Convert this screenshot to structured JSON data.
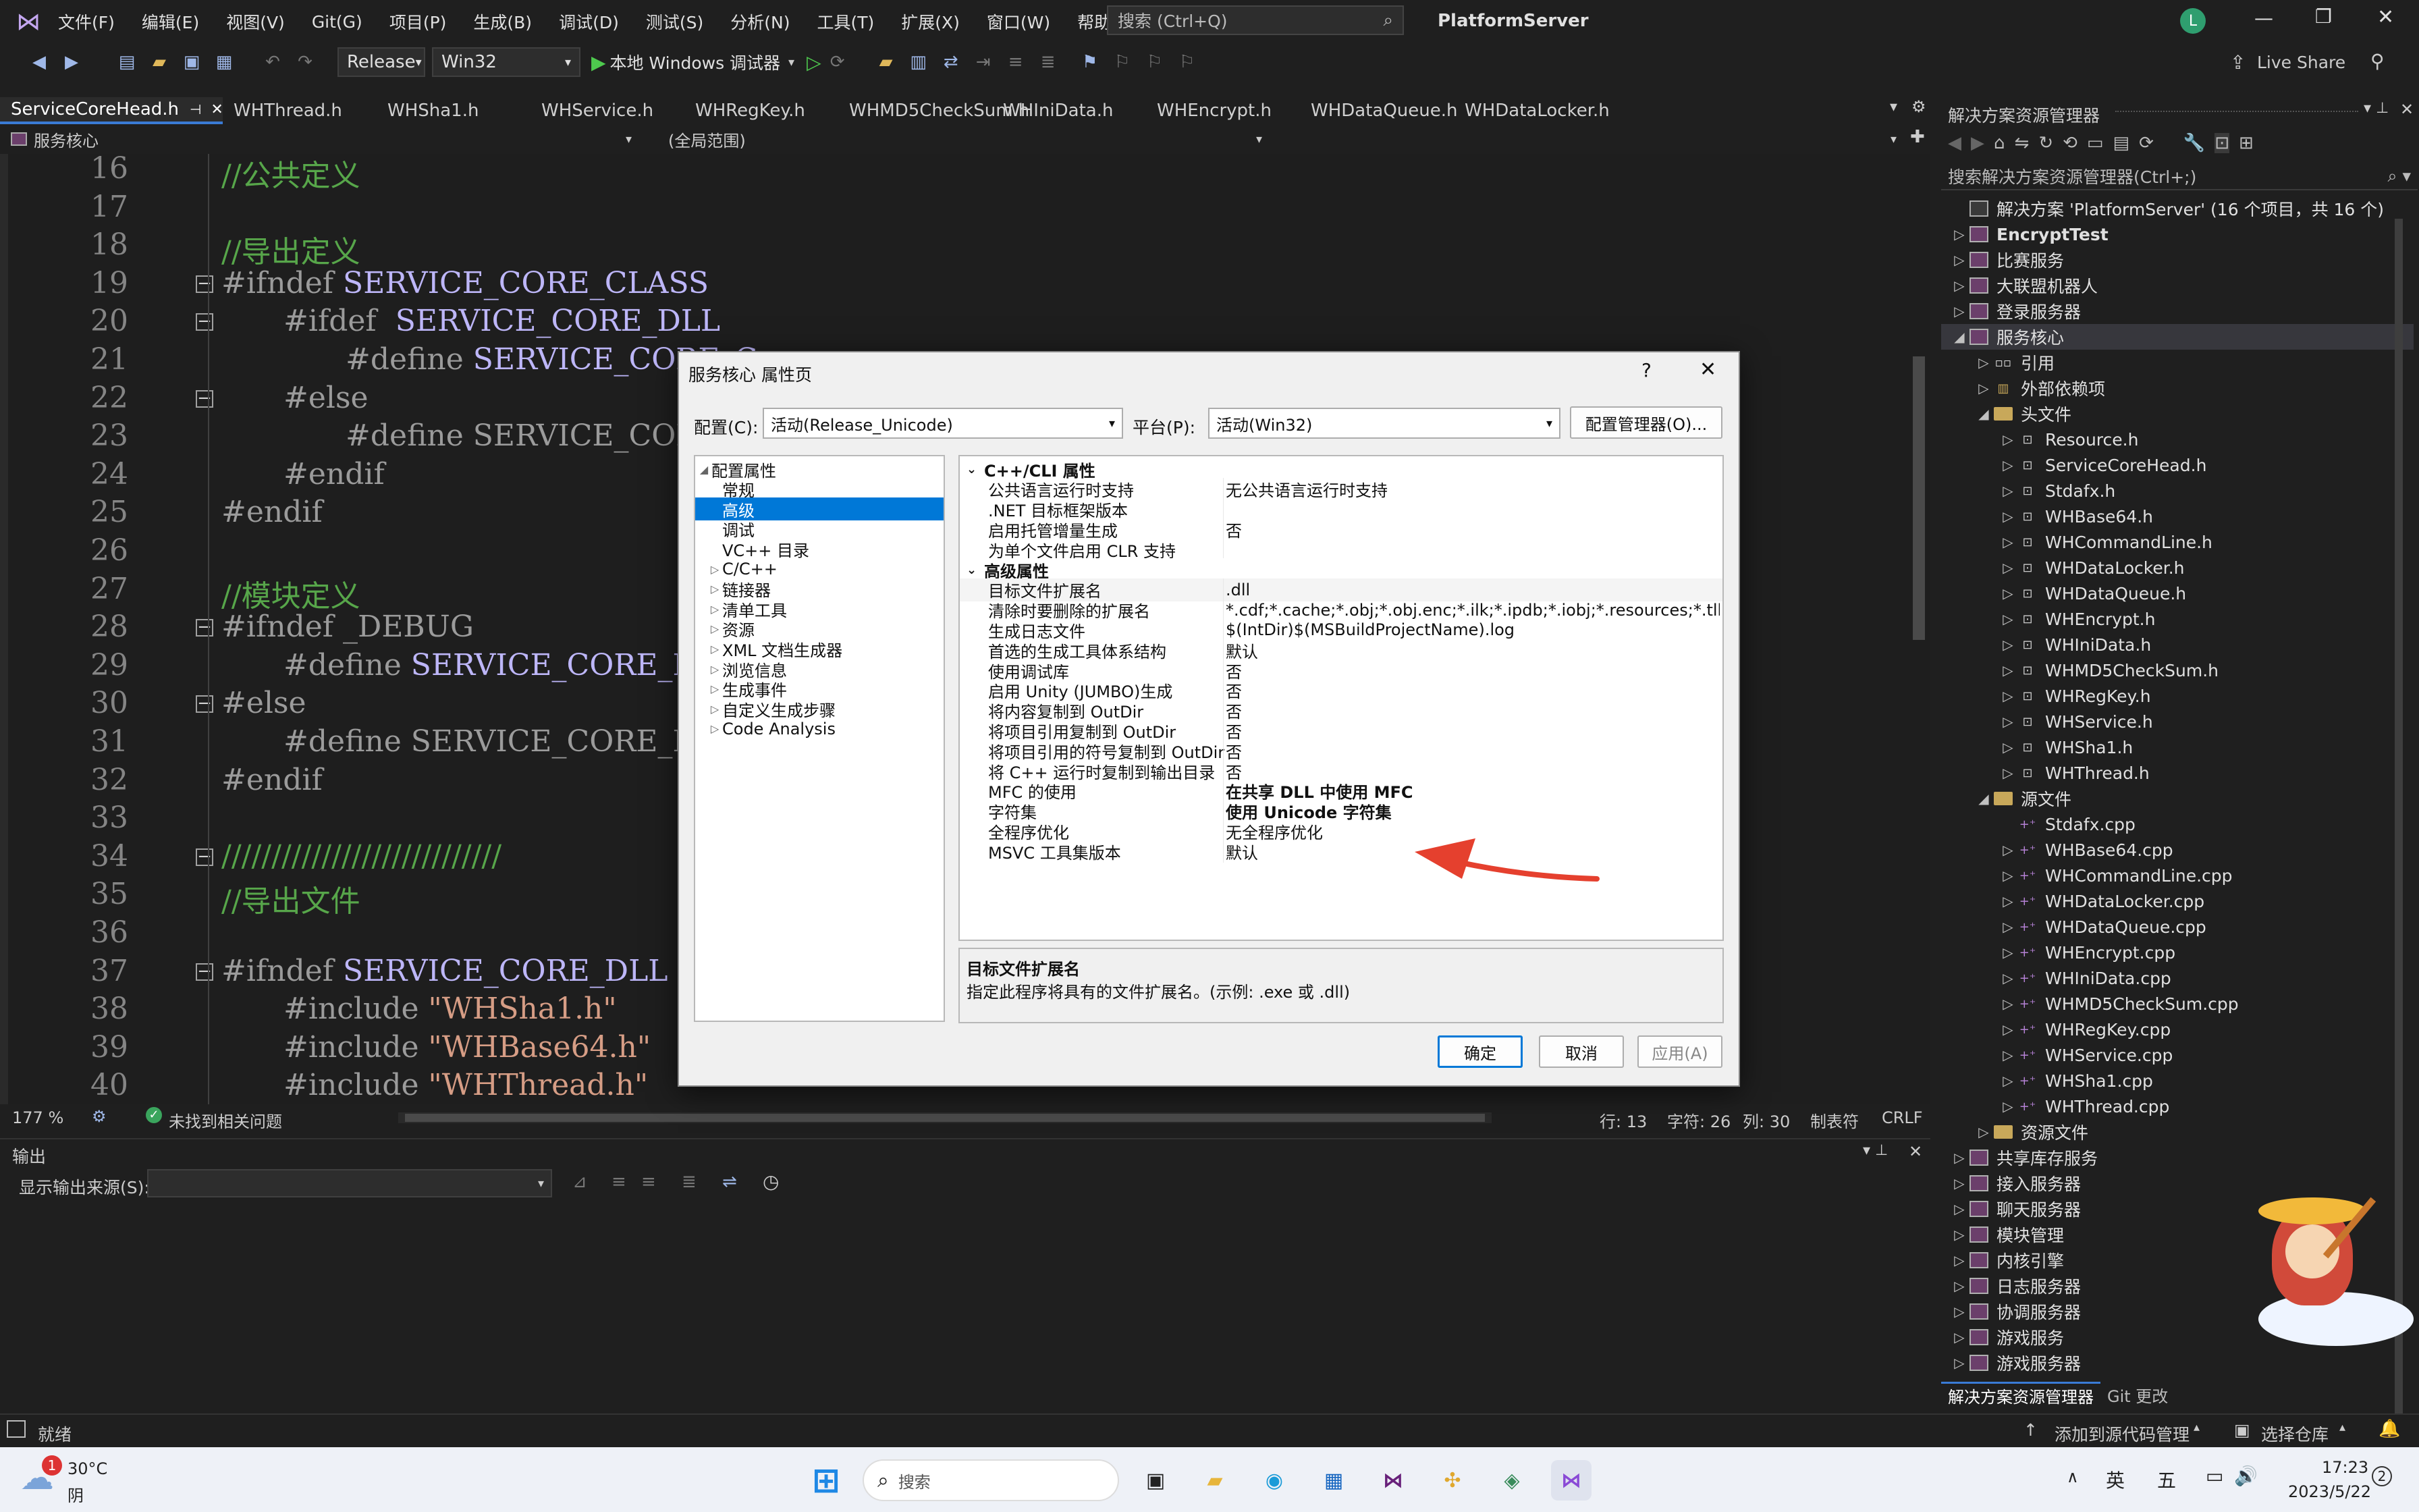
{
  "title_bar": {
    "menus": [
      "文件(F)",
      "编辑(E)",
      "视图(V)",
      "Git(G)",
      "项目(P)",
      "生成(B)",
      "调试(D)",
      "测试(S)",
      "分析(N)",
      "工具(T)",
      "扩展(X)",
      "窗口(W)",
      "帮助(H)"
    ],
    "search_placeholder": "搜索 (Ctrl+Q)",
    "solution_name": "PlatformServer",
    "avatar_letter": "L"
  },
  "toolbar": {
    "config": "Release",
    "platform": "Win32",
    "debugger": "本地 Windows 调试器",
    "live_share": "Live Share"
  },
  "tabs": [
    "ServiceCoreHead.h",
    "WHThread.h",
    "WHSha1.h",
    "WHService.h",
    "WHRegKey.h",
    "WHMD5CheckSum.h",
    "WHIniData.h",
    "WHEncrypt.h",
    "WHDataQueue.h",
    "WHDataLocker.h"
  ],
  "nav": {
    "project": "服务核心",
    "scope": "(全局范围)"
  },
  "editor": {
    "lines": [
      {
        "n": "16",
        "t": "//公共定义",
        "k": "cm",
        "i": 0
      },
      {
        "n": "17",
        "t": "",
        "k": "",
        "i": 0
      },
      {
        "n": "18",
        "t": "//导出定义",
        "k": "cm",
        "i": 0
      },
      {
        "n": "19",
        "t": "#ifndef ",
        "m": "SERVICE_CORE_CLASS",
        "k": "pp",
        "i": 0,
        "f": true
      },
      {
        "n": "20",
        "t": "#ifdef  ",
        "m": "SERVICE_CORE_DLL",
        "k": "pp",
        "i": 1,
        "f": true
      },
      {
        "n": "21",
        "t": "#define ",
        "m": "SERVICE_CORE_C",
        "k": "pp",
        "i": 2
      },
      {
        "n": "22",
        "t": "#else",
        "k": "pp",
        "i": 1,
        "f": true
      },
      {
        "n": "23",
        "t": "#define SERVICE_CORE_C",
        "k": "pp",
        "i": 2
      },
      {
        "n": "24",
        "t": "#endif",
        "k": "pp",
        "i": 1
      },
      {
        "n": "25",
        "t": "#endif",
        "k": "pp",
        "i": 0
      },
      {
        "n": "26",
        "t": "",
        "k": "",
        "i": 0
      },
      {
        "n": "27",
        "t": "//模块定义",
        "k": "cm",
        "i": 0
      },
      {
        "n": "28",
        "t": "#ifndef _DEBUG",
        "k": "pp",
        "i": 0,
        "f": true
      },
      {
        "n": "29",
        "t": "#define ",
        "m": "SERVICE_CORE_DLL_N",
        "k": "pp",
        "i": 1
      },
      {
        "n": "30",
        "t": "#else",
        "k": "pp",
        "i": 0,
        "f": true
      },
      {
        "n": "31",
        "t": "#define SERVICE_CORE_DLL_N",
        "k": "pp",
        "i": 1
      },
      {
        "n": "32",
        "t": "#endif",
        "k": "pp",
        "i": 0
      },
      {
        "n": "33",
        "t": "",
        "k": "",
        "i": 0
      },
      {
        "n": "34",
        "t": "////////////////////////////",
        "k": "cm",
        "i": 0,
        "f": true
      },
      {
        "n": "35",
        "t": "//导出文件",
        "k": "cm",
        "i": 0
      },
      {
        "n": "36",
        "t": "",
        "k": "",
        "i": 0
      },
      {
        "n": "37",
        "t": "#ifndef ",
        "m": "SERVICE_CORE_DLL",
        "k": "pp",
        "i": 0,
        "f": true
      },
      {
        "n": "38",
        "t": "#include ",
        "s": "\"WHSha1.h\"",
        "k": "pp",
        "i": 1
      },
      {
        "n": "39",
        "t": "#include ",
        "s": "\"WHBase64.h\"",
        "k": "pp",
        "i": 1
      },
      {
        "n": "40",
        "t": "#include ",
        "s": "\"WHThread.h\"",
        "k": "pp",
        "i": 1
      }
    ]
  },
  "editor_status": {
    "zoom": "177 %",
    "issues": "未找到相关问题",
    "line": "行: 13",
    "char": "字符: 26",
    "col": "列: 30",
    "tabs": "制表符",
    "eol": "CRLF"
  },
  "output": {
    "title": "输出",
    "source_label": "显示输出来源(S):"
  },
  "solution_explorer": {
    "title": "解决方案资源管理器",
    "search_placeholder": "搜索解决方案资源管理器(Ctrl+;)",
    "bottom_tabs": [
      "解决方案资源管理器",
      "Git 更改"
    ],
    "items": [
      {
        "l": "解决方案 'PlatformServer' (16 个项目，共 16 个)",
        "d": 0,
        "t": "sol",
        "a": ""
      },
      {
        "l": "EncryptTest",
        "d": 0,
        "t": "proj",
        "a": "▷",
        "b": true
      },
      {
        "l": "比赛服务",
        "d": 0,
        "t": "proj",
        "a": "▷"
      },
      {
        "l": "大联盟机器人",
        "d": 0,
        "t": "proj",
        "a": "▷"
      },
      {
        "l": "登录服务器",
        "d": 0,
        "t": "proj",
        "a": "▷"
      },
      {
        "l": "服务核心",
        "d": 0,
        "t": "proj",
        "a": "◢",
        "sel": true
      },
      {
        "l": "引用",
        "d": 1,
        "t": "ref",
        "a": "▷"
      },
      {
        "l": "外部依赖项",
        "d": 1,
        "t": "ext",
        "a": "▷"
      },
      {
        "l": "头文件",
        "d": 1,
        "t": "folder",
        "a": "◢"
      },
      {
        "l": "Resource.h",
        "d": 2,
        "t": "h",
        "a": "▷"
      },
      {
        "l": "ServiceCoreHead.h",
        "d": 2,
        "t": "h",
        "a": "▷"
      },
      {
        "l": "Stdafx.h",
        "d": 2,
        "t": "h",
        "a": "▷"
      },
      {
        "l": "WHBase64.h",
        "d": 2,
        "t": "h",
        "a": "▷"
      },
      {
        "l": "WHCommandLine.h",
        "d": 2,
        "t": "h",
        "a": "▷"
      },
      {
        "l": "WHDataLocker.h",
        "d": 2,
        "t": "h",
        "a": "▷"
      },
      {
        "l": "WHDataQueue.h",
        "d": 2,
        "t": "h",
        "a": "▷"
      },
      {
        "l": "WHEncrypt.h",
        "d": 2,
        "t": "h",
        "a": "▷"
      },
      {
        "l": "WHIniData.h",
        "d": 2,
        "t": "h",
        "a": "▷"
      },
      {
        "l": "WHMD5CheckSum.h",
        "d": 2,
        "t": "h",
        "a": "▷"
      },
      {
        "l": "WHRegKey.h",
        "d": 2,
        "t": "h",
        "a": "▷"
      },
      {
        "l": "WHService.h",
        "d": 2,
        "t": "h",
        "a": "▷"
      },
      {
        "l": "WHSha1.h",
        "d": 2,
        "t": "h",
        "a": "▷"
      },
      {
        "l": "WHThread.h",
        "d": 2,
        "t": "h",
        "a": "▷"
      },
      {
        "l": "源文件",
        "d": 1,
        "t": "folder",
        "a": "◢"
      },
      {
        "l": "Stdafx.cpp",
        "d": 2,
        "t": "cpp",
        "a": ""
      },
      {
        "l": "WHBase64.cpp",
        "d": 2,
        "t": "cpp",
        "a": "▷"
      },
      {
        "l": "WHCommandLine.cpp",
        "d": 2,
        "t": "cpp",
        "a": "▷"
      },
      {
        "l": "WHDataLocker.cpp",
        "d": 2,
        "t": "cpp",
        "a": "▷"
      },
      {
        "l": "WHDataQueue.cpp",
        "d": 2,
        "t": "cpp",
        "a": "▷"
      },
      {
        "l": "WHEncrypt.cpp",
        "d": 2,
        "t": "cpp",
        "a": "▷"
      },
      {
        "l": "WHIniData.cpp",
        "d": 2,
        "t": "cpp",
        "a": "▷"
      },
      {
        "l": "WHMD5CheckSum.cpp",
        "d": 2,
        "t": "cpp",
        "a": "▷"
      },
      {
        "l": "WHRegKey.cpp",
        "d": 2,
        "t": "cpp",
        "a": "▷"
      },
      {
        "l": "WHService.cpp",
        "d": 2,
        "t": "cpp",
        "a": "▷"
      },
      {
        "l": "WHSha1.cpp",
        "d": 2,
        "t": "cpp",
        "a": "▷"
      },
      {
        "l": "WHThread.cpp",
        "d": 2,
        "t": "cpp",
        "a": "▷"
      },
      {
        "l": "资源文件",
        "d": 1,
        "t": "folder",
        "a": "▷"
      },
      {
        "l": "共享库存服务",
        "d": 0,
        "t": "proj",
        "a": "▷"
      },
      {
        "l": "接入服务器",
        "d": 0,
        "t": "proj",
        "a": "▷"
      },
      {
        "l": "聊天服务器",
        "d": 0,
        "t": "proj",
        "a": "▷"
      },
      {
        "l": "模块管理",
        "d": 0,
        "t": "proj",
        "a": "▷"
      },
      {
        "l": "内核引擎",
        "d": 0,
        "t": "proj",
        "a": "▷"
      },
      {
        "l": "日志服务器",
        "d": 0,
        "t": "proj",
        "a": "▷"
      },
      {
        "l": "协调服务器",
        "d": 0,
        "t": "proj",
        "a": "▷"
      },
      {
        "l": "游戏服务",
        "d": 0,
        "t": "proj",
        "a": "▷"
      },
      {
        "l": "游戏服务器",
        "d": 0,
        "t": "proj",
        "a": "▷"
      }
    ]
  },
  "status_bar": {
    "ready": "就绪",
    "source_control": "添加到源代码管理",
    "repo": "选择仓库",
    "notify": "2"
  },
  "taskbar": {
    "temp": "30°C",
    "weather": "阴",
    "search": "搜索",
    "ime1": "英",
    "ime2": "五",
    "time": "17:23",
    "date": "2023/5/22",
    "badge": "1"
  },
  "dialog": {
    "title": "服务核心 属性页",
    "help": "?",
    "config_label": "配置(C):",
    "config_value": "活动(Release_Unicode)",
    "platform_label": "平台(P):",
    "platform_value": "活动(Win32)",
    "config_mgr": "配置管理器(O)...",
    "categories": [
      {
        "l": "配置属性",
        "d": 0,
        "a": "◢"
      },
      {
        "l": "常规",
        "d": 1,
        "a": ""
      },
      {
        "l": "高级",
        "d": 1,
        "a": "",
        "sel": true
      },
      {
        "l": "调试",
        "d": 1,
        "a": ""
      },
      {
        "l": "VC++ 目录",
        "d": 1,
        "a": ""
      },
      {
        "l": "C/C++",
        "d": 1,
        "a": "▷"
      },
      {
        "l": "链接器",
        "d": 1,
        "a": "▷"
      },
      {
        "l": "清单工具",
        "d": 1,
        "a": "▷"
      },
      {
        "l": "资源",
        "d": 1,
        "a": "▷"
      },
      {
        "l": "XML 文档生成器",
        "d": 1,
        "a": "▷"
      },
      {
        "l": "浏览信息",
        "d": 1,
        "a": "▷"
      },
      {
        "l": "生成事件",
        "d": 1,
        "a": "▷"
      },
      {
        "l": "自定义生成步骤",
        "d": 1,
        "a": "▷"
      },
      {
        "l": "Code Analysis",
        "d": 1,
        "a": "▷"
      }
    ],
    "properties": [
      {
        "g": "C++/CLI 属性"
      },
      {
        "n": "公共语言运行时支持",
        "v": "无公共语言运行时支持"
      },
      {
        "n": ".NET 目标框架版本",
        "v": ""
      },
      {
        "n": "启用托管增量生成",
        "v": "否"
      },
      {
        "n": "为单个文件启用 CLR 支持",
        "v": ""
      },
      {
        "g": "高级属性"
      },
      {
        "n": "目标文件扩展名",
        "v": ".dll",
        "sel": true
      },
      {
        "n": "清除时要删除的扩展名",
        "v": "*.cdf;*.cache;*.obj;*.obj.enc;*.ilk;*.ipdb;*.iobj;*.resources;*.tlb;*.tli"
      },
      {
        "n": "生成日志文件",
        "v": "$(IntDir)$(MSBuildProjectName).log"
      },
      {
        "n": "首选的生成工具体系结构",
        "v": "默认"
      },
      {
        "n": "使用调试库",
        "v": "否"
      },
      {
        "n": "启用 Unity (JUMBO)生成",
        "v": "否"
      },
      {
        "n": "将内容复制到 OutDir",
        "v": "否"
      },
      {
        "n": "将项目引用复制到 OutDir",
        "v": "否"
      },
      {
        "n": "将项目引用的符号复制到 OutDir",
        "v": "否"
      },
      {
        "n": "将 C++ 运行时复制到输出目录",
        "v": "否"
      },
      {
        "n": "MFC 的使用",
        "v": "在共享 DLL 中使用 MFC",
        "b": true
      },
      {
        "n": "字符集",
        "v": "使用 Unicode 字符集",
        "b": true
      },
      {
        "n": "全程序优化",
        "v": "无全程序优化"
      },
      {
        "n": "MSVC 工具集版本",
        "v": "默认"
      }
    ],
    "desc_title": "目标文件扩展名",
    "desc_text": "指定此程序将具有的文件扩展名。(示例: .exe 或 .dll)",
    "ok": "确定",
    "cancel": "取消",
    "apply": "应用(A)"
  },
  "colors": {
    "accent": "#0078d7",
    "arrow": "#e5402e",
    "vs_purple": "#68217a"
  }
}
